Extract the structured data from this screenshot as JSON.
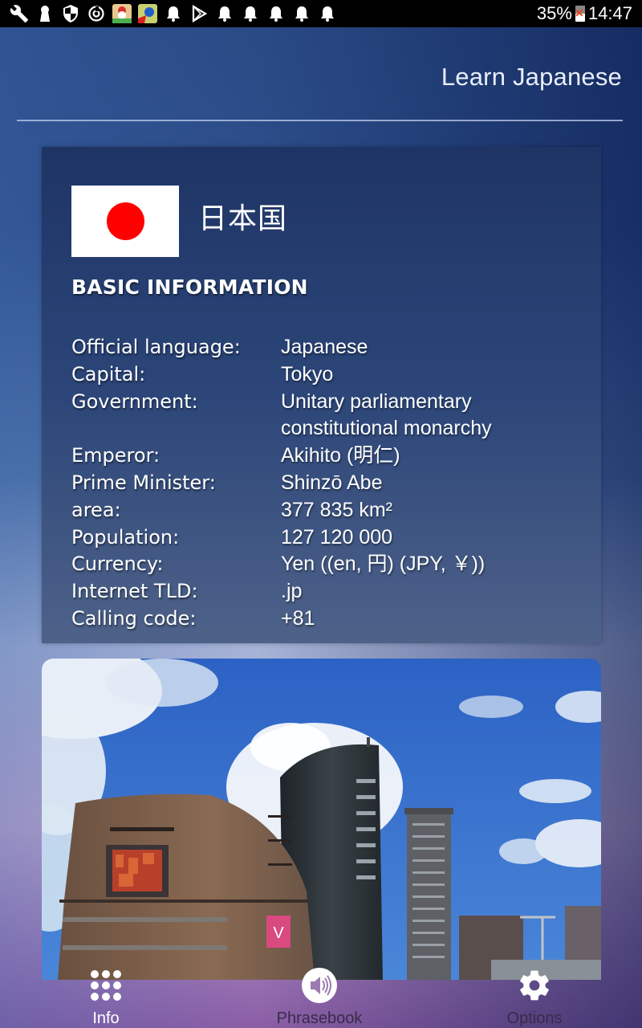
{
  "status_bar": {
    "left_icons": [
      "wrench-icon",
      "keyhole-icon",
      "shield-icon",
      "sync-icon",
      "game-app-icon-1",
      "game-app-icon-2",
      "bell-icon",
      "play-store-icon",
      "bell-icon",
      "bell-icon",
      "bell-icon",
      "bell-icon",
      "bell-icon"
    ],
    "battery_percent": "35%",
    "battery_icon": "battery-not-charging-icon",
    "time": "14:47"
  },
  "header": {
    "title": "Learn Japanese"
  },
  "info_card": {
    "flag": "japan-flag",
    "flag_colors": {
      "field": "#ffffff",
      "disc": "#ff0000"
    },
    "country_name": "日本国",
    "section_title": "BASIC INFORMATION",
    "facts": [
      {
        "label": "Official language:",
        "value": "Japanese"
      },
      {
        "label": "Capital:",
        "value": "Tokyo"
      },
      {
        "label": "Government:",
        "value": "Unitary parliamentary"
      },
      {
        "label": "",
        "value": "constitutional monarchy"
      },
      {
        "label": "Emperor:",
        "value": "Akihito (明仁)"
      },
      {
        "label": "Prime Minister:",
        "value": "Shinzō Abe"
      },
      {
        "label": "area:",
        "value": "377 835 km²"
      },
      {
        "label": "Population:",
        "value": "127 120 000"
      },
      {
        "label": "Currency:",
        "value": "Yen ((en, 円) (JPY, ￥))"
      },
      {
        "label": "Internet TLD:",
        "value": ".jp"
      },
      {
        "label": "Calling code:",
        "value": "+81"
      }
    ]
  },
  "photo": {
    "description": "city-skyline-photo"
  },
  "bottom_nav": {
    "items": [
      {
        "label": "Info",
        "icon": "grid-dots-icon",
        "active": true
      },
      {
        "label": "Phrasebook",
        "icon": "speaker-icon",
        "active": false
      },
      {
        "label": "Options",
        "icon": "gear-icon",
        "active": false
      }
    ]
  }
}
